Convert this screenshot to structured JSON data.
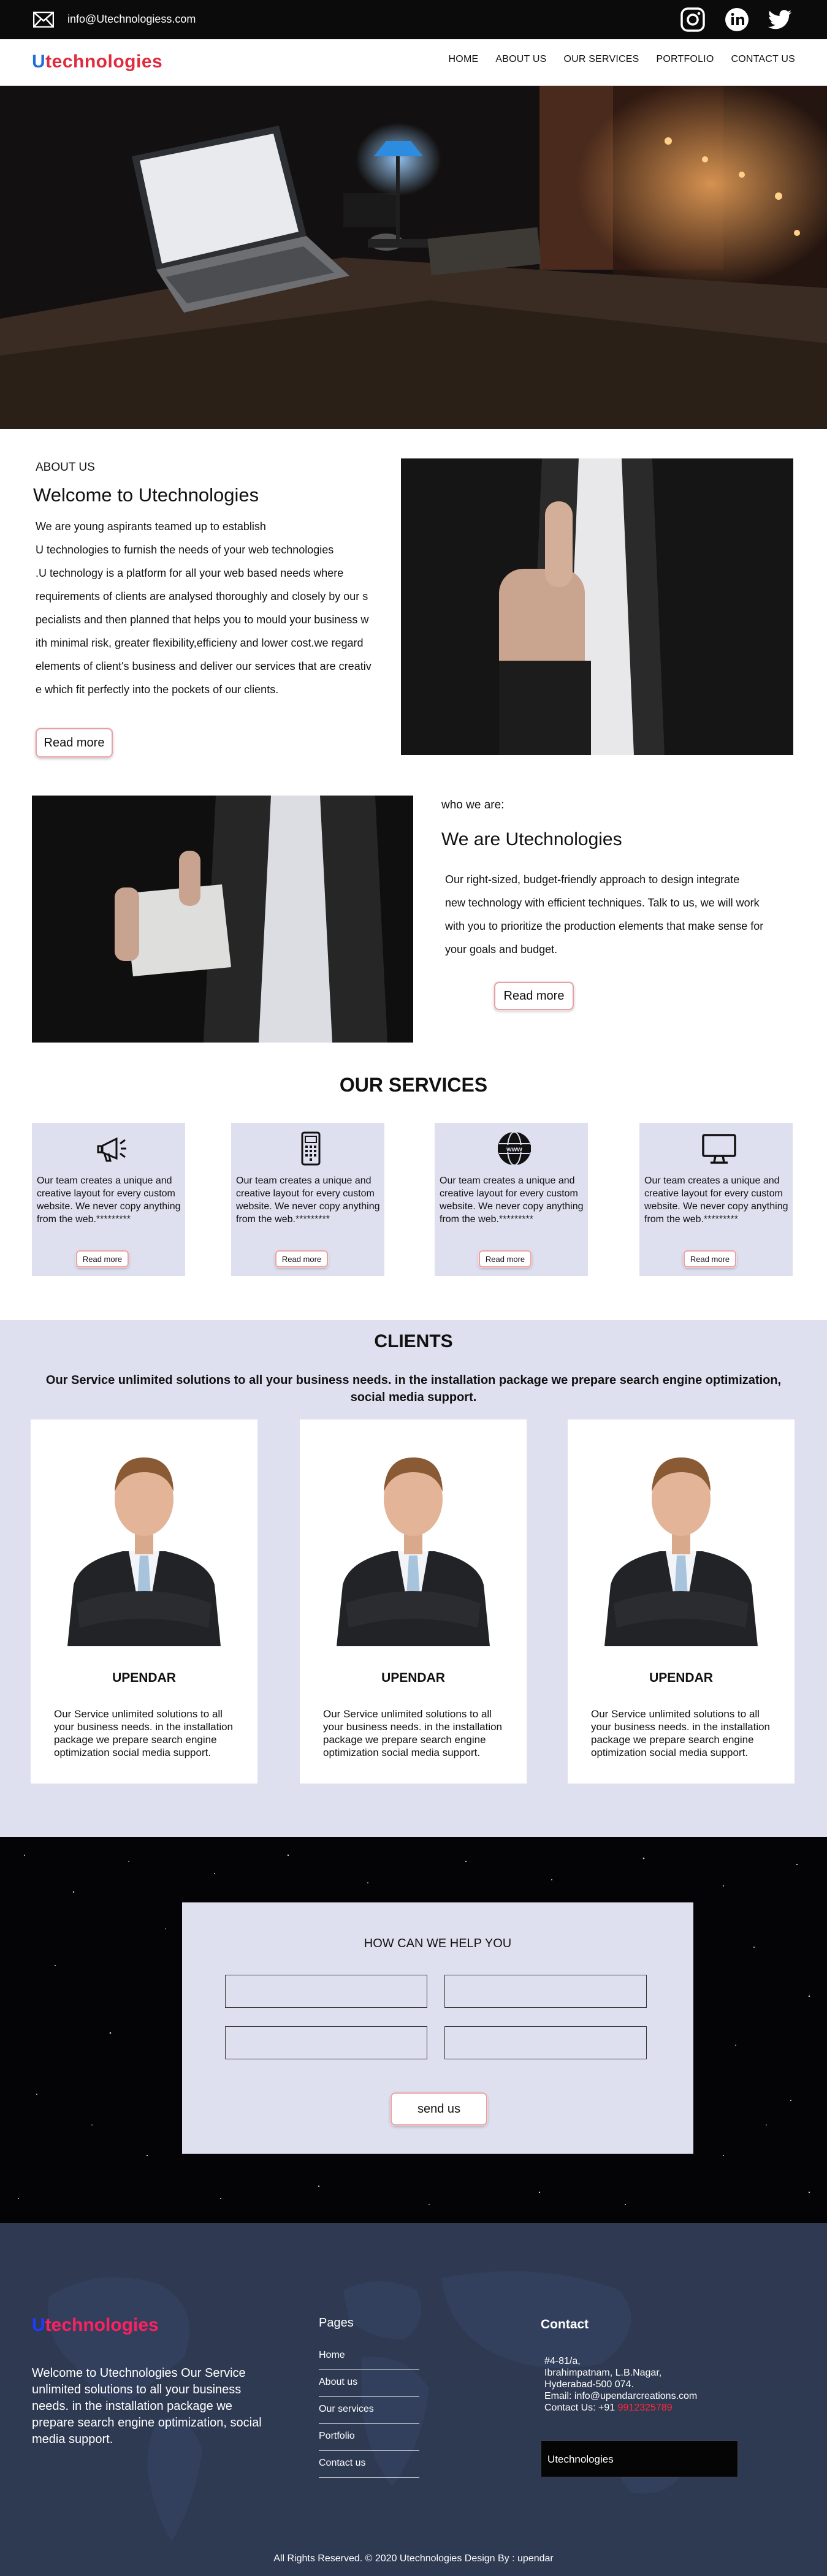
{
  "topbar": {
    "email": "info@Utechnologiess.com",
    "icons": [
      "mail-icon",
      "instagram-icon",
      "linkedin-icon",
      "twitter-icon"
    ]
  },
  "brand": {
    "first": "U",
    "rest": "technologies",
    "colors": {
      "u": "#1f6fd6",
      "rest": "#e02a3d"
    }
  },
  "nav": {
    "items": [
      "HOME",
      "ABOUT US",
      "OUR SERVICES",
      "PORTFOLIO",
      "CONTACT US"
    ]
  },
  "about": {
    "label": "ABOUT US",
    "title": "Welcome to Utechnologies",
    "lines": [
      "We are young aspirants teamed up to establish",
      "U technologies to furnish the needs of your web technologies",
      ".U technology is a platform for all your web based needs where",
      "requirements of clients are analysed thoroughly and closely by our s",
      "pecialists and then planned that helps you to mould your business w",
      "ith minimal risk, greater flexibility,efficieny and lower cost.we regard",
      "elements of client's business and deliver our services that are creativ",
      "e which fit perfectly into the pockets of our clients."
    ],
    "button": "Read more"
  },
  "who": {
    "label": "who  we  are:",
    "title": "We are Utechnologies",
    "lines": [
      "Our right-sized, budget-friendly approach to design integrate",
      "new technology with efficient techniques. Talk to us, we will work",
      " with you to prioritize the production elements that make sense for",
      " your goals and budget."
    ],
    "button": "Read more"
  },
  "services": {
    "title": "OUR SERVICES",
    "cards": [
      {
        "icon": "megaphone-icon",
        "text": "Our team creates a unique and creative layout for every custom website. We never copy anything from the web.*********",
        "button": "Read more"
      },
      {
        "icon": "mobile-keypad-icon",
        "text": "Our team creates a unique and creative layout for every custom website. We never copy anything from the web.*********",
        "button": "Read more"
      },
      {
        "icon": "www-globe-icon",
        "text": "Our team creates a unique and creative layout for every custom website. We never copy anything from the web.*********",
        "button": "Read more"
      },
      {
        "icon": "monitor-icon",
        "text": "Our team creates a unique and creative layout for every custom website. We never copy anything from the web.*********",
        "button": "Read more"
      }
    ]
  },
  "clients": {
    "title": "CLIENTS",
    "subtitle": "Our Service unlimited solutions to all your business needs. in the installation package we prepare search engine optimization, social media support.",
    "cards": [
      {
        "name": "UPENDAR",
        "text": "Our Service unlimited solutions to all your business needs. in the installation package we prepare search engine optimization  social media support."
      },
      {
        "name": "UPENDAR",
        "text": "Our Service unlimited solutions to all your business needs. in the installation package we prepare search engine optimization  social media support."
      },
      {
        "name": "UPENDAR",
        "text": "Our Service unlimited solutions to all your business needs. in the installation package we prepare search engine optimization  social media support."
      }
    ]
  },
  "contact_form": {
    "title": "HOW CAN WE HELP YOU",
    "fields": [
      "",
      "",
      "",
      ""
    ],
    "button": "send us"
  },
  "footer": {
    "about": "Welcome to Utechnologies Our Service unlimited solutions to all your business needs. in the installation package we prepare search engine optimization, social media support.",
    "pages_title": "Pages",
    "links": [
      "Home",
      "About us",
      "Our services",
      "Portfolio",
      "Contact us"
    ],
    "contact_title": "Contact",
    "address_lines": [
      "#4-81/a,",
      "Ibrahimpatnam, L.B.Nagar,",
      "Hyderabad-500 074."
    ],
    "email_line": "Email: info@upendarcreations.com",
    "phone_label": "Contact Us: +91 ",
    "phone_number": "9912325789",
    "brand_box": "Utechnologies",
    "copyright": "All Rights Reserved. © 2020 Utechnologies Design By : upendar"
  }
}
